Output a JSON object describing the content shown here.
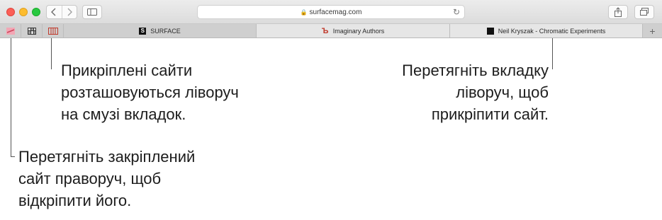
{
  "browser": {
    "address": "surfacemag.com",
    "tabs": [
      {
        "label": "SURFACE",
        "favicon": "S",
        "active": false
      },
      {
        "label": "Imaginary Authors",
        "favicon": "IA",
        "active": true
      },
      {
        "label": "Neil Kryszak - Chromatic Experiments",
        "favicon": "NK",
        "active": true
      }
    ]
  },
  "callouts": {
    "pinned_sites": [
      "Прикріплені сайти",
      "розташовуються ліворуч",
      "на смузі вкладок."
    ],
    "drag_tab": [
      "Перетягніть вкладку",
      "ліворуч, щоб",
      "прикріпити сайт."
    ],
    "unpin": [
      "Перетягніть закріплений",
      "сайт праворуч, щоб",
      "відкріпити його."
    ]
  }
}
